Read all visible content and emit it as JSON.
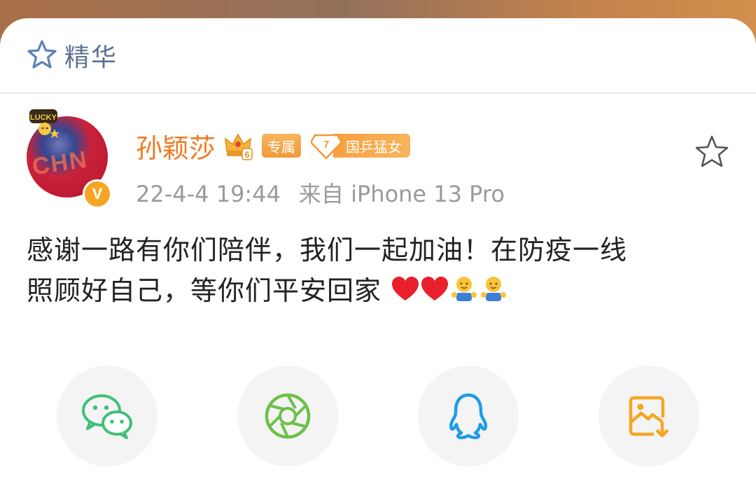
{
  "header": {
    "featured_label": "精华"
  },
  "post": {
    "user_name": "孙颖莎",
    "badge_exclusive": "专属",
    "fan_level": "7",
    "fan_badge_label": "国乒猛女",
    "avatar_text": "CHN",
    "lucky_text": "LUCKY",
    "verified_mark": "V",
    "crown_level": "6",
    "timestamp": "22-4-4 19:44",
    "source": "来自 iPhone 13 Pro",
    "text_line1": "感谢一路有你们陪伴，我们一起加油！在防疫一线",
    "text_line2": "照顾好自己，等你们平安回家"
  },
  "share": {
    "items": [
      "wechat-icon",
      "moments-icon",
      "qq-icon",
      "save-image-icon"
    ]
  },
  "colors": {
    "accent": "#f07a22",
    "featured_text": "#5d7191",
    "wechat": "#3fc07a",
    "moments": "#6cc04a",
    "qq": "#1e9be8",
    "save": "#f5a623"
  }
}
